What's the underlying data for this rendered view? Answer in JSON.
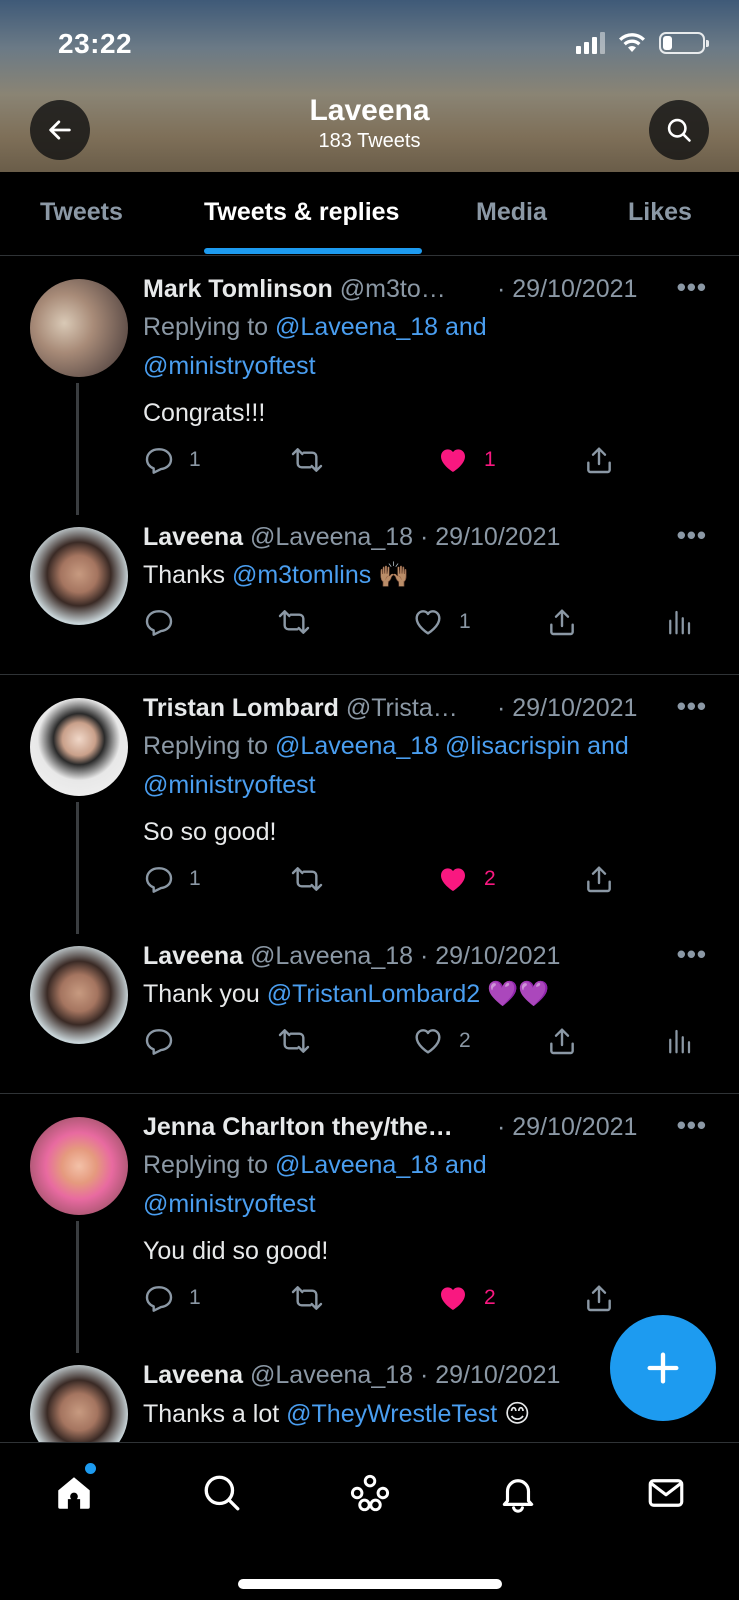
{
  "status_bar": {
    "time": "23:22"
  },
  "header": {
    "title": "Laveena",
    "subtitle": "183 Tweets"
  },
  "tabs": [
    {
      "label": "Tweets"
    },
    {
      "label": "Tweets & replies"
    },
    {
      "label": "Media"
    },
    {
      "label": "Likes"
    }
  ],
  "active_tab": "Tweets & replies",
  "tweets": [
    {
      "name": "Mark Tomlinson",
      "handle": "@m3to…",
      "sep": "·",
      "date": "29/10/2021",
      "replying_prefix": "Replying to",
      "replying_links": "@Laveena_18 and",
      "replying_line2": "@ministryoftest",
      "text": "Congrats!!!",
      "replies": "1",
      "likes": "1",
      "liked": true
    },
    {
      "name": "Laveena",
      "handle": "@Laveena_18",
      "sep": "·",
      "date": "29/10/2021",
      "text_prefix": "Thanks",
      "text_link": "@m3tomlins",
      "text_emoji": "🙌🏽",
      "likes": "1",
      "liked": false
    },
    {
      "name": "Tristan Lombard",
      "handle": "@Trista…",
      "sep": "·",
      "date": "29/10/2021",
      "replying_prefix": "Replying to",
      "replying_links": "@Laveena_18 @lisacrispin and",
      "replying_line2": "@ministryoftest",
      "text": "So so good!",
      "replies": "1",
      "likes": "2",
      "liked": true
    },
    {
      "name": "Laveena",
      "handle": "@Laveena_18",
      "sep": "·",
      "date": "29/10/2021",
      "text_prefix": "Thank you",
      "text_link": "@TristanLombard2",
      "text_emoji": "💜💜",
      "likes": "2",
      "liked": false
    },
    {
      "name": "Jenna Charlton they/the…",
      "handle": "",
      "sep": "·",
      "date": "29/10/2021",
      "replying_prefix": "Replying to",
      "replying_links": "@Laveena_18 and",
      "replying_line2": "@ministryoftest",
      "text": "You did so good!",
      "replies": "1",
      "likes": "2",
      "liked": true
    },
    {
      "name": "Laveena",
      "handle": "@Laveena_18",
      "sep": "·",
      "date": "29/10/2021",
      "text_prefix": "Thanks a lot",
      "text_link": "@TheyWrestleTest",
      "text_emoji": "😊"
    }
  ],
  "colors": {
    "accent": "#1d9bf0",
    "like": "#f91880",
    "muted": "#8b98a5",
    "link": "#4a9ef0"
  },
  "icons": [
    "back-arrow-icon",
    "search-icon",
    "reply-icon",
    "retweet-icon",
    "heart-icon",
    "share-icon",
    "analytics-icon",
    "more-icon",
    "compose-plus-icon",
    "home-icon",
    "explore-icon",
    "spaces-icon",
    "notifications-icon",
    "messages-icon"
  ]
}
